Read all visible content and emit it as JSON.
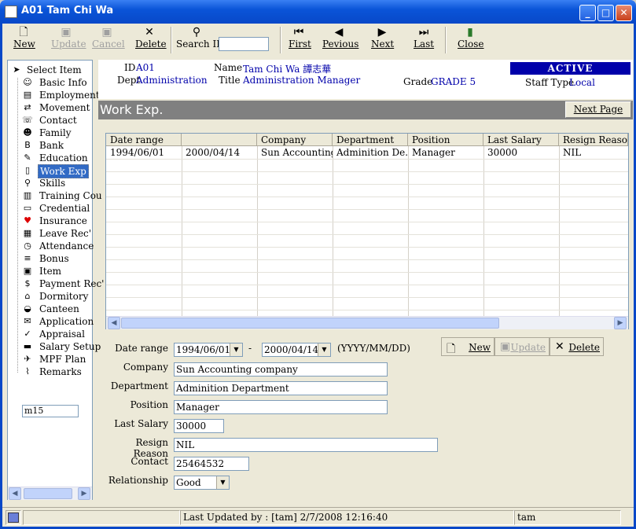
{
  "window": {
    "title": "A01 Tam Chi Wa"
  },
  "toolbar": {
    "new": "New",
    "update": "Update",
    "cancel": "Cancel",
    "delete": "Delete",
    "search_label": "Search ID",
    "search_value": "",
    "first": "First",
    "previous": "Pevious",
    "next": "Next",
    "last": "Last",
    "close": "Close"
  },
  "sidebar": {
    "items": [
      {
        "label": "Select Item",
        "icon": "arrow-cursor-icon"
      },
      {
        "label": "Basic Info",
        "icon": "person-icon"
      },
      {
        "label": "Employment",
        "icon": "briefcase-icon"
      },
      {
        "label": "Movement",
        "icon": "move-icon"
      },
      {
        "label": "Contact",
        "icon": "contact-icon"
      },
      {
        "label": "Family",
        "icon": "family-icon"
      },
      {
        "label": "Bank",
        "icon": "bank-icon"
      },
      {
        "label": "Education",
        "icon": "education-icon"
      },
      {
        "label": "Work Exp",
        "icon": "document-icon"
      },
      {
        "label": "Skills",
        "icon": "skills-icon"
      },
      {
        "label": "Training Cou",
        "icon": "training-icon"
      },
      {
        "label": "Credential",
        "icon": "credential-icon"
      },
      {
        "label": "Insurance",
        "icon": "heart-icon"
      },
      {
        "label": "Leave Rec'",
        "icon": "calendar-icon"
      },
      {
        "label": "Attendance",
        "icon": "clock-icon"
      },
      {
        "label": "Bonus",
        "icon": "bonus-icon"
      },
      {
        "label": "Item",
        "icon": "item-icon"
      },
      {
        "label": "Payment Rec'",
        "icon": "payment-icon"
      },
      {
        "label": "Dormitory",
        "icon": "house-icon"
      },
      {
        "label": "Canteen",
        "icon": "canteen-icon"
      },
      {
        "label": "Application",
        "icon": "application-icon"
      },
      {
        "label": "Appraisal",
        "icon": "appraisal-icon"
      },
      {
        "label": "Salary Setup",
        "icon": "salary-icon"
      },
      {
        "label": "MPF Plan",
        "icon": "mpf-icon"
      },
      {
        "label": "Remarks",
        "icon": "paperclip-icon"
      }
    ],
    "selected_index": 8,
    "input_value": "m15"
  },
  "employee": {
    "id_label": "ID",
    "id": "A01",
    "name_label": "Name",
    "name": "Tam Chi Wa  譚志華",
    "dept_label": "Dept",
    "dept": "Administration",
    "title_label": "Title",
    "title": "Administration Manager",
    "grade_label": "Grade",
    "grade": "GRADE 5",
    "status": "ACTIVE",
    "staff_type_label": "Staff Type",
    "staff_type": "Local"
  },
  "section": {
    "title": "Work Exp.",
    "next_page": "Next Page"
  },
  "grid": {
    "columns": [
      "Date range",
      "",
      "Company",
      "Department",
      "Position",
      "Last Salary",
      "Resign Reason"
    ],
    "rows": [
      [
        "1994/06/01",
        "2000/04/14",
        "Sun Accounting...",
        "Adminition De...",
        "Manager",
        "30000",
        "NIL"
      ]
    ]
  },
  "form": {
    "date_range_label": "Date range",
    "date_from": "1994/06/01",
    "date_sep": "-",
    "date_to": "2000/04/14",
    "date_format": "(YYYY/MM/DD)",
    "company_label": "Company",
    "company": "Sun Accounting company",
    "department_label": "Department",
    "department": "Adminition Department",
    "position_label": "Position",
    "position": "Manager",
    "last_salary_label": "Last Salary",
    "last_salary": "30000",
    "resign_reason_label": "Resign Reason",
    "resign_reason": "NIL",
    "contact_label": "Contact",
    "contact": "25464532",
    "relationship_label": "Relationship",
    "relationship": "Good",
    "new_btn": "New",
    "update_btn": "Update",
    "delete_btn": "Delete"
  },
  "status": {
    "last_updated": "Last Updated by : [tam]  2/7/2008 12:16:40",
    "user": "tam"
  }
}
